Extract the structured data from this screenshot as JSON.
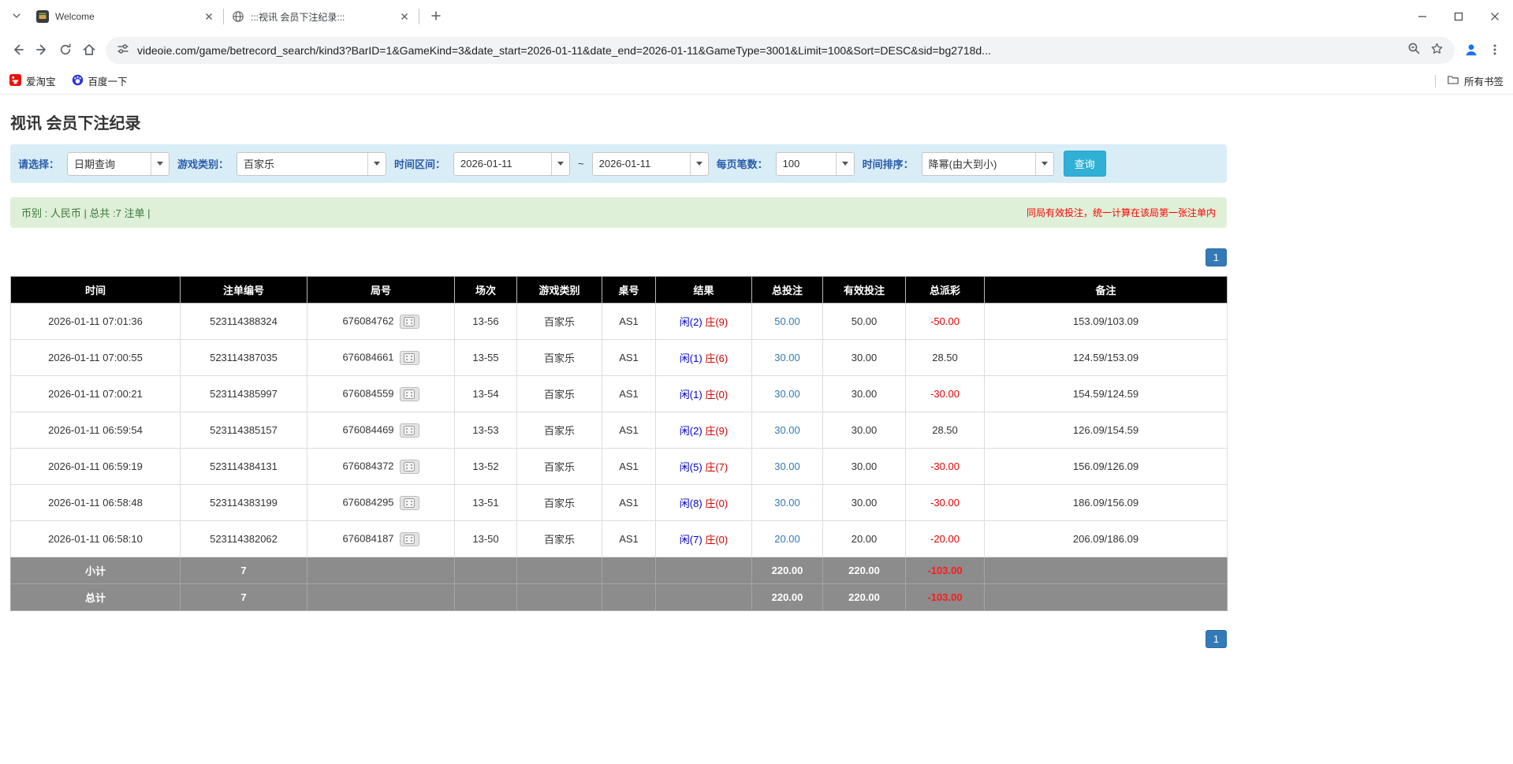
{
  "colors": {
    "accent_blue": "#337ab7",
    "header_bg": "#000000",
    "filter_bg": "#d9edf7",
    "summary_bg": "#dff0d8",
    "label_blue": "#2a5caa",
    "btn_info": "#31b0d5",
    "negative_red": "#e60000",
    "notice_red": "#ff0000",
    "player_blue": "#0000d0",
    "banker_red": "#d00000",
    "footer_gray": "#8c8c8c"
  },
  "browser": {
    "tabs": [
      {
        "title": "Welcome"
      },
      {
        "title": ":::视讯 会员下注纪录:::"
      }
    ],
    "url": "videoie.com/game/betrecord_search/kind3?BarID=1&GameKind=3&date_start=2026-01-11&date_end=2026-01-11&GameType=3001&Limit=100&Sort=DESC&sid=bg2718d...",
    "bookmarks": {
      "item1": "爱淘宝",
      "item2": "百度一下",
      "all_bookmarks": "所有书签"
    }
  },
  "page": {
    "title": "视讯 会员下注纪录",
    "filters": {
      "select_label": "请选择：",
      "select_value": "日期查询",
      "game_label": "游戏类别：",
      "game_value": "百家乐",
      "range_label": "时间区间：",
      "date_start": "2026-01-11",
      "range_sep": "~",
      "date_end": "2026-01-11",
      "per_page_label": "每页笔数：",
      "per_page_value": "100",
      "sort_label": "时间排序：",
      "sort_value": "降幂(由大到小)",
      "search_button": "查询"
    },
    "summary": {
      "left": "币别 : 人民币 | 总共 :7 注单 |",
      "right": "同局有效投注，统一计算在该局第一张注单内"
    },
    "pagination": {
      "page": "1"
    },
    "table": {
      "headers": {
        "time": "时间",
        "bet_id": "注单编号",
        "round": "局号",
        "session": "场次",
        "game": "游戏类别",
        "table_no": "桌号",
        "result": "结果",
        "total_bet": "总投注",
        "valid_bet": "有效投注",
        "payout": "总派彩",
        "note": "备注"
      },
      "rows": [
        {
          "time": "2026-01-11 07:01:36",
          "bet_id": "523114388324",
          "round": "676084762",
          "session": "13-56",
          "game": "百家乐",
          "table_no": "AS1",
          "player": "闲(2)",
          "banker": "庄(9)",
          "total_bet": "50.00",
          "valid_bet": "50.00",
          "payout": "-50.00",
          "note": "153.09/103.09"
        },
        {
          "time": "2026-01-11 07:00:55",
          "bet_id": "523114387035",
          "round": "676084661",
          "session": "13-55",
          "game": "百家乐",
          "table_no": "AS1",
          "player": "闲(1)",
          "banker": "庄(6)",
          "total_bet": "30.00",
          "valid_bet": "30.00",
          "payout": "28.50",
          "note": "124.59/153.09"
        },
        {
          "time": "2026-01-11 07:00:21",
          "bet_id": "523114385997",
          "round": "676084559",
          "session": "13-54",
          "game": "百家乐",
          "table_no": "AS1",
          "player": "闲(1)",
          "banker": "庄(0)",
          "total_bet": "30.00",
          "valid_bet": "30.00",
          "payout": "-30.00",
          "note": "154.59/124.59"
        },
        {
          "time": "2026-01-11 06:59:54",
          "bet_id": "523114385157",
          "round": "676084469",
          "session": "13-53",
          "game": "百家乐",
          "table_no": "AS1",
          "player": "闲(2)",
          "banker": "庄(9)",
          "total_bet": "30.00",
          "valid_bet": "30.00",
          "payout": "28.50",
          "note": "126.09/154.59"
        },
        {
          "time": "2026-01-11 06:59:19",
          "bet_id": "523114384131",
          "round": "676084372",
          "session": "13-52",
          "game": "百家乐",
          "table_no": "AS1",
          "player": "闲(5)",
          "banker": "庄(7)",
          "total_bet": "30.00",
          "valid_bet": "30.00",
          "payout": "-30.00",
          "note": "156.09/126.09"
        },
        {
          "time": "2026-01-11 06:58:48",
          "bet_id": "523114383199",
          "round": "676084295",
          "session": "13-51",
          "game": "百家乐",
          "table_no": "AS1",
          "player": "闲(8)",
          "banker": "庄(0)",
          "total_bet": "30.00",
          "valid_bet": "30.00",
          "payout": "-30.00",
          "note": "186.09/156.09"
        },
        {
          "time": "2026-01-11 06:58:10",
          "bet_id": "523114382062",
          "round": "676084187",
          "session": "13-50",
          "game": "百家乐",
          "table_no": "AS1",
          "player": "闲(7)",
          "banker": "庄(0)",
          "total_bet": "20.00",
          "valid_bet": "20.00",
          "payout": "-20.00",
          "note": "206.09/186.09"
        }
      ],
      "subtotal": {
        "label": "小计",
        "count": "7",
        "total_bet": "220.00",
        "valid_bet": "220.00",
        "payout": "-103.00"
      },
      "total": {
        "label": "总计",
        "count": "7",
        "total_bet": "220.00",
        "valid_bet": "220.00",
        "payout": "-103.00"
      }
    }
  }
}
